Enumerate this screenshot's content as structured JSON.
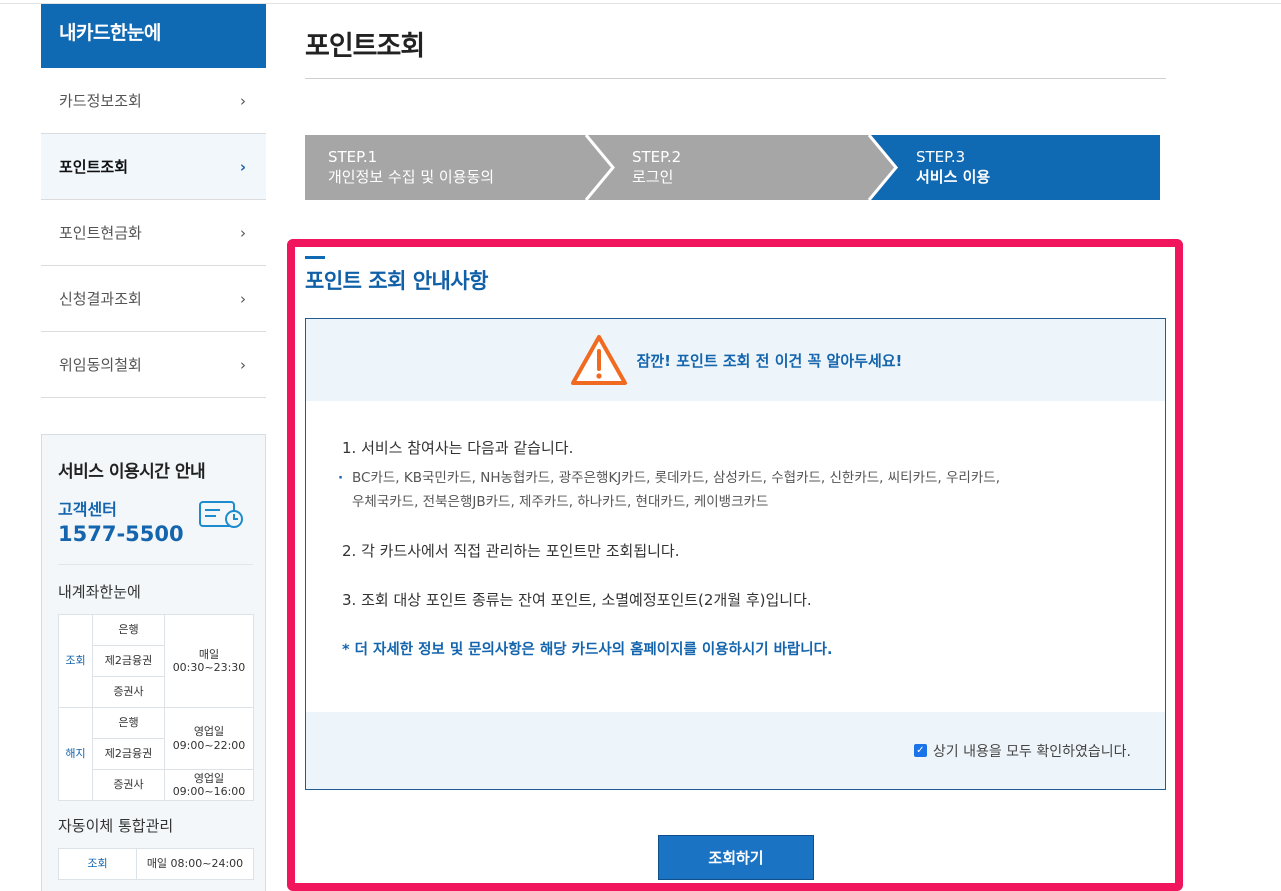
{
  "sidebar": {
    "header": "내카드한눈에",
    "items": [
      {
        "label": "카드정보조회"
      },
      {
        "label": "포인트조회"
      },
      {
        "label": "포인트현금화"
      },
      {
        "label": "신청결과조회"
      },
      {
        "label": "위임동의철회"
      }
    ],
    "chevron": "›",
    "service_hours": {
      "title": "서비스 이용시간 안내",
      "cs_label": "고객센터",
      "cs_phone": "1577-5500",
      "account_title": "내계좌한눈에",
      "rows": {
        "inquiry_label": "조회",
        "cancel_label": "해지",
        "bank": "은행",
        "fin2": "제2금융권",
        "securities": "증권사",
        "inquiry_time_day": "매일",
        "inquiry_time": "00:30~23:30",
        "cancel_bank_day": "영업일",
        "cancel_bank_time": "09:00~22:00",
        "cancel_sec_day": "영업일",
        "cancel_sec_time": "09:00~16:00"
      },
      "auto_title": "자동이체 통합관리",
      "auto_row": {
        "label": "조회",
        "time": "매일 08:00~24:00"
      }
    }
  },
  "main": {
    "title": "포인트조회",
    "steps": [
      {
        "num": "STEP.1",
        "label": "개인정보 수집 및 이용동의"
      },
      {
        "num": "STEP.2",
        "label": "로그인"
      },
      {
        "num": "STEP.3",
        "label": "서비스 이용"
      }
    ],
    "section_title": "포인트 조회 안내사항",
    "notice": {
      "warning": "잠깐! 포인트 조회 전 이건 꼭 알아두세요!",
      "item1": "1. 서비스 참여사는 다음과 같습니다.",
      "item1_detail_line1": "BC카드, KB국민카드, NH농협카드, 광주은행KJ카드, 롯데카드, 삼성카드, 수협카드, 신한카드, 씨티카드, 우리카드,",
      "item1_detail_line2": "우체국카드, 전북은행JB카드, 제주카드, 하나카드, 현대카드, 케이뱅크카드",
      "item2": "2. 각 카드사에서 직접 관리하는 포인트만 조회됩니다.",
      "item3": "3. 조회 대상 포인트 종류는 잔여 포인트, 소멸예정포인트(2개월 후)입니다.",
      "note": "* 더 자세한 정보 및 문의사항은 해당 카드사의 홈페이지를 이용하시기 바랍니다.",
      "confirm_label": "상기 내용을 모두 확인하였습니다.",
      "confirm_checked": true
    },
    "search_button": "조회하기"
  },
  "colors": {
    "brand": "#1069b3",
    "highlight": "#f0155d",
    "step_inactive": "#a6a6a6"
  }
}
